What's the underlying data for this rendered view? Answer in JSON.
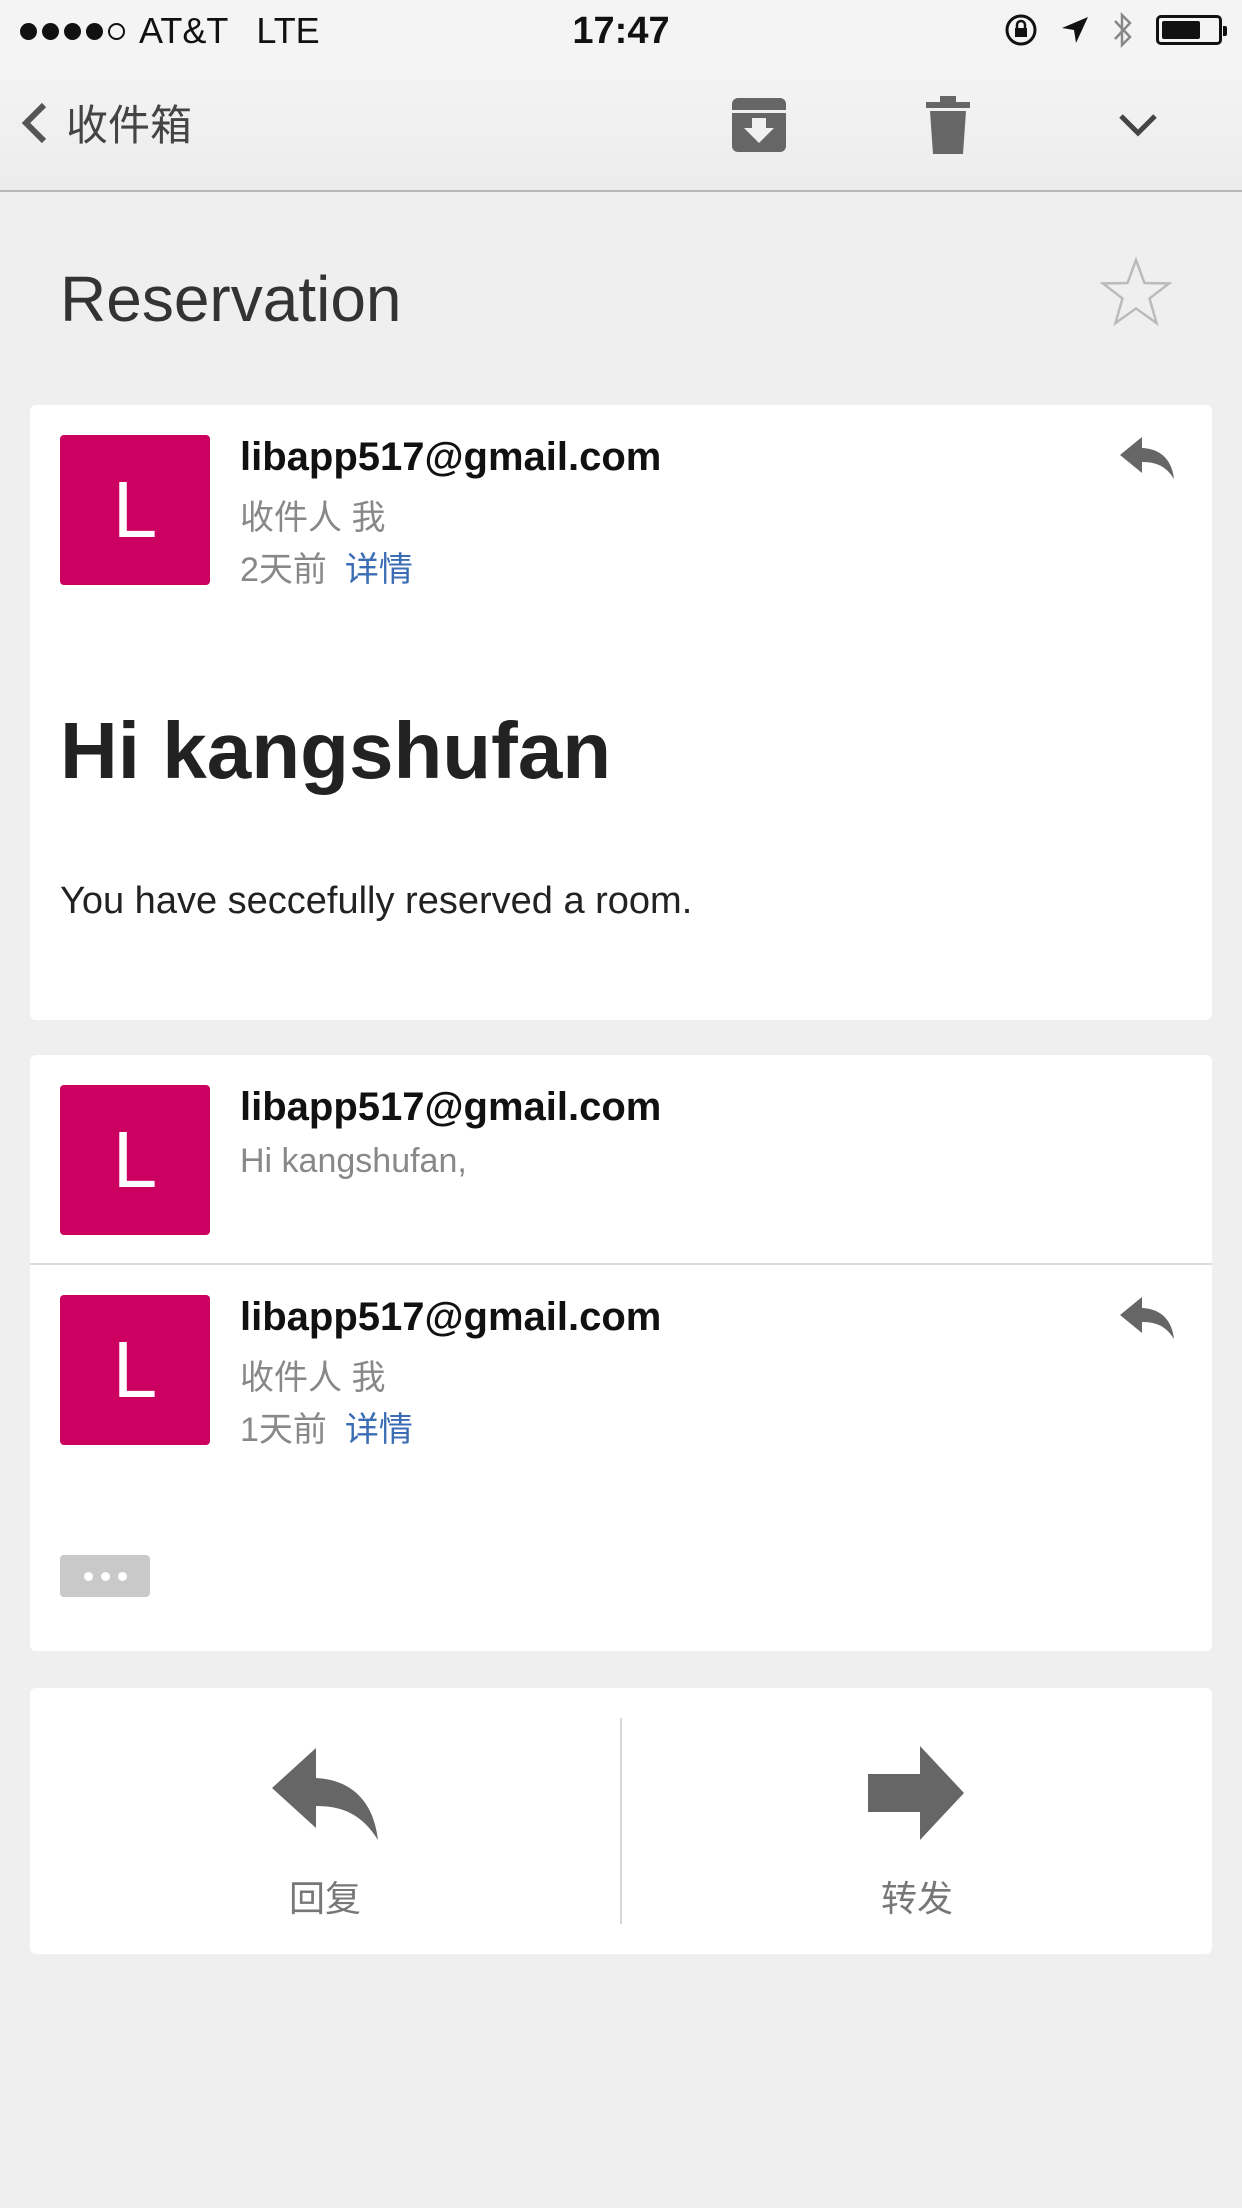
{
  "status_bar": {
    "carrier": "AT&T",
    "network": "LTE",
    "time": "17:47",
    "signal_bars_filled": 4,
    "signal_bars_total": 5
  },
  "nav": {
    "back_label": "收件箱",
    "icons": [
      "archive-icon",
      "trash-icon",
      "chevron-down-icon"
    ]
  },
  "thread": {
    "subject": "Reservation"
  },
  "messages": [
    {
      "avatar_letter": "L",
      "sender": "libapp517@gmail.com",
      "to_line": "收件人 我",
      "time": "2天前",
      "details_label": "详情",
      "greeting": "Hi kangshufan",
      "body": "You have seccefully reserved a room."
    },
    {
      "avatar_letter": "L",
      "sender": "libapp517@gmail.com",
      "snippet": "Hi kangshufan,"
    },
    {
      "avatar_letter": "L",
      "sender": "libapp517@gmail.com",
      "to_line": "收件人 我",
      "time": "1天前",
      "details_label": "详情"
    }
  ],
  "actions": {
    "reply_label": "回复",
    "forward_label": "转发"
  },
  "colors": {
    "avatar": "#cc0060",
    "link": "#3b6db5",
    "background": "#efefef"
  }
}
